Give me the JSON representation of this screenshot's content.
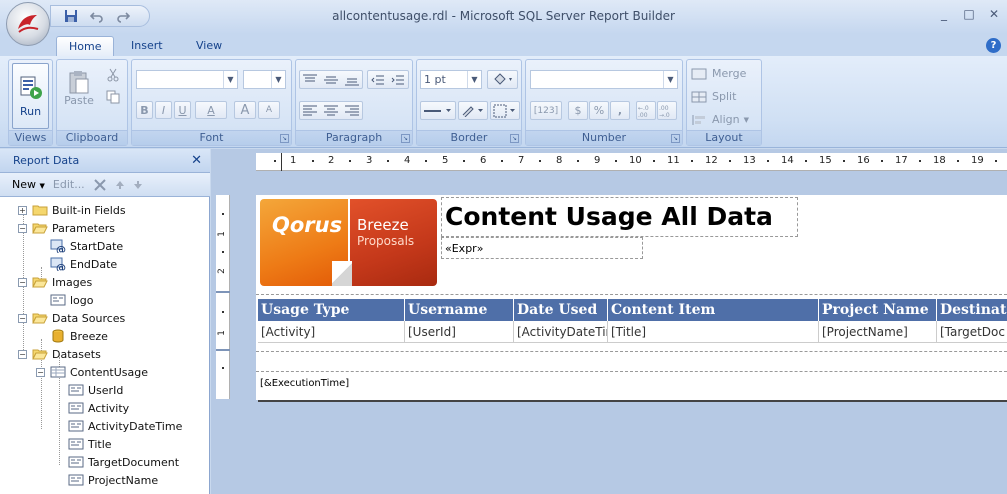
{
  "window": {
    "title": "allcontentusage.rdl - Microsoft SQL Server Report Builder",
    "minimize": "_",
    "maximize": "□",
    "close": "✕"
  },
  "tabs": [
    {
      "label": "Home",
      "active": true
    },
    {
      "label": "Insert",
      "active": false
    },
    {
      "label": "View",
      "active": false
    }
  ],
  "help": "?",
  "ribbon": {
    "views": {
      "label": "Views",
      "run_label": "Run"
    },
    "clipboard": {
      "label": "Clipboard",
      "paste_label": "Paste"
    },
    "font": {
      "label": "Font",
      "bold": "B",
      "italic": "I",
      "underline": "U",
      "color": "A",
      "grow": "A",
      "shrink": "A"
    },
    "paragraph": {
      "label": "Paragraph"
    },
    "border": {
      "label": "Border",
      "width_value": "1 pt"
    },
    "number": {
      "label": "Number",
      "placeholder_btn": "[123]",
      "currency": "$",
      "percent": "%",
      "comma": ","
    },
    "layout": {
      "label": "Layout",
      "merge": "Merge",
      "split": "Split",
      "align": "Align"
    }
  },
  "report_data": {
    "title": "Report Data",
    "close": "✕",
    "toolbar": {
      "new": "New",
      "edit": "Edit..."
    },
    "tree": [
      {
        "label": "Built-in Fields",
        "expander": "+"
      },
      {
        "label": "Parameters",
        "expander": "−"
      },
      {
        "label": "StartDate"
      },
      {
        "label": "EndDate"
      },
      {
        "label": "Images",
        "expander": "−"
      },
      {
        "label": "logo"
      },
      {
        "label": "Data Sources",
        "expander": "−"
      },
      {
        "label": "Breeze"
      },
      {
        "label": "Datasets",
        "expander": "−"
      },
      {
        "label": "ContentUsage",
        "expander": "−"
      },
      {
        "label": "UserId"
      },
      {
        "label": "Activity"
      },
      {
        "label": "ActivityDateTime"
      },
      {
        "label": "Title"
      },
      {
        "label": "TargetDocument"
      },
      {
        "label": "ProjectName"
      }
    ]
  },
  "ruler": {
    "h_numbers": [
      "1",
      "2",
      "3",
      "4",
      "5",
      "6",
      "7",
      "8",
      "9",
      "10",
      "11",
      "12",
      "13",
      "14",
      "15",
      "16",
      "17",
      "18",
      "19"
    ],
    "v_numbers": [
      "1",
      "2",
      "1"
    ]
  },
  "report": {
    "logo": {
      "qorus": "Qorus",
      "breeze": "Breeze",
      "proposals": "Proposals"
    },
    "title": "Content Usage All Data",
    "expr": "«Expr»",
    "columns": [
      "Usage Type",
      "Username",
      "Date Used",
      "Content Item",
      "Project Name",
      "Destinat"
    ],
    "row": [
      "[Activity]",
      "[UserId]",
      "[ActivityDateTin",
      "[Title]",
      "[ProjectName]",
      "[TargetDoc"
    ],
    "footer": "[&ExecutionTime]"
  }
}
